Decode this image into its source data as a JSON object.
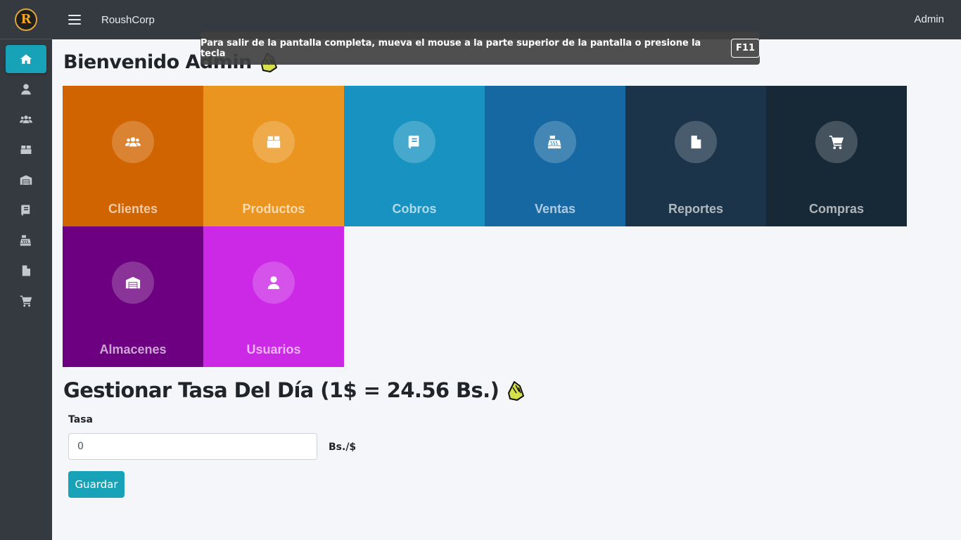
{
  "app": {
    "brand": "RoushCorp",
    "logo_letter": "R",
    "user": "Admin"
  },
  "toast": {
    "message": "Para salir de la pantalla completa, mueva el mouse a la parte superior de la pantalla o presione la tecla",
    "key": "F11"
  },
  "sidebar": {
    "items": [
      {
        "icon": "home-icon",
        "active": true
      },
      {
        "icon": "user-icon",
        "active": false
      },
      {
        "icon": "users-icon",
        "active": false
      },
      {
        "icon": "box-icon",
        "active": false
      },
      {
        "icon": "warehouse-icon",
        "active": false
      },
      {
        "icon": "book-icon",
        "active": false
      },
      {
        "icon": "cash-register-icon",
        "active": false
      },
      {
        "icon": "file-icon",
        "active": false
      },
      {
        "icon": "cart-icon",
        "active": false
      }
    ]
  },
  "main": {
    "welcome": "Bienvenido Admin",
    "tiles": [
      {
        "label": "Clientes",
        "icon": "users-icon",
        "color": "#d06401"
      },
      {
        "label": "Productos",
        "icon": "box-icon",
        "color": "#ea951f"
      },
      {
        "label": "Cobros",
        "icon": "book-icon",
        "color": "#1893c1"
      },
      {
        "label": "Ventas",
        "icon": "cash-register-icon",
        "color": "#1668a2"
      },
      {
        "label": "Reportes",
        "icon": "file-icon",
        "color": "#1b3449"
      },
      {
        "label": "Compras",
        "icon": "cart-icon",
        "color": "#172937"
      },
      {
        "label": "Almacenes",
        "icon": "warehouse-icon",
        "color": "#6d0080"
      },
      {
        "label": "Usuarios",
        "icon": "user-icon",
        "color": "#cb29e6"
      }
    ],
    "rate_title": "Gestionar Tasa Del Día (1$ = 24.56 Bs.)",
    "rate_label": "Tasa",
    "rate_value": "0",
    "rate_unit": "Bs./$",
    "save_label": "Guardar"
  }
}
